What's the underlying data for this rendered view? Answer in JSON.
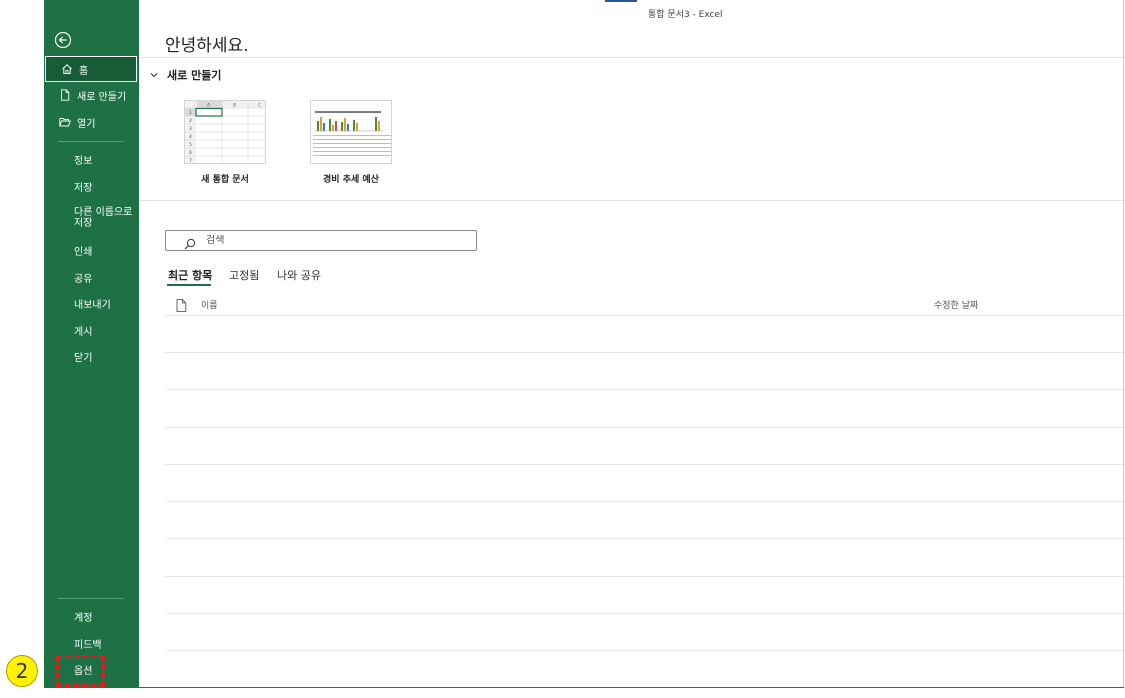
{
  "window": {
    "title": "통합 문서3  -  Excel"
  },
  "sidebar": {
    "back_icon": "back-arrow-icon",
    "items": [
      {
        "label": "홈",
        "icon": "home-icon",
        "selected": true
      },
      {
        "label": "새로 만들기",
        "icon": "new-document-icon"
      },
      {
        "label": "열기",
        "icon": "open-folder-icon"
      },
      {
        "label": "정보"
      },
      {
        "label": "저장"
      },
      {
        "label": "다른 이름으로 저장"
      },
      {
        "label": "인쇄"
      },
      {
        "label": "공유"
      },
      {
        "label": "내보내기"
      },
      {
        "label": "게시"
      },
      {
        "label": "닫기"
      }
    ],
    "bottom_items": [
      {
        "label": "계정"
      },
      {
        "label": "피드백"
      },
      {
        "label": "옵션"
      }
    ]
  },
  "main": {
    "greeting": "안녕하세요.",
    "new_section": {
      "label": "새로 만들기"
    },
    "templates": [
      {
        "label": "새 통합 문서",
        "columns": [
          "A",
          "B",
          "C"
        ],
        "rows": [
          "1",
          "2",
          "3",
          "4",
          "5",
          "6",
          "7"
        ]
      },
      {
        "label": "경비 추세 예산"
      }
    ],
    "search": {
      "placeholder": "검색"
    },
    "tabs": [
      {
        "label": "최근 항목",
        "active": true
      },
      {
        "label": "고정됨"
      },
      {
        "label": "나와 공유"
      }
    ],
    "list_headers": {
      "name": "이름",
      "modified": "수정한 날짜"
    }
  },
  "annotation": {
    "number": "2"
  },
  "colors": {
    "accent": "#1e7145",
    "highlight": "#e02020",
    "badge": "#fff200"
  }
}
